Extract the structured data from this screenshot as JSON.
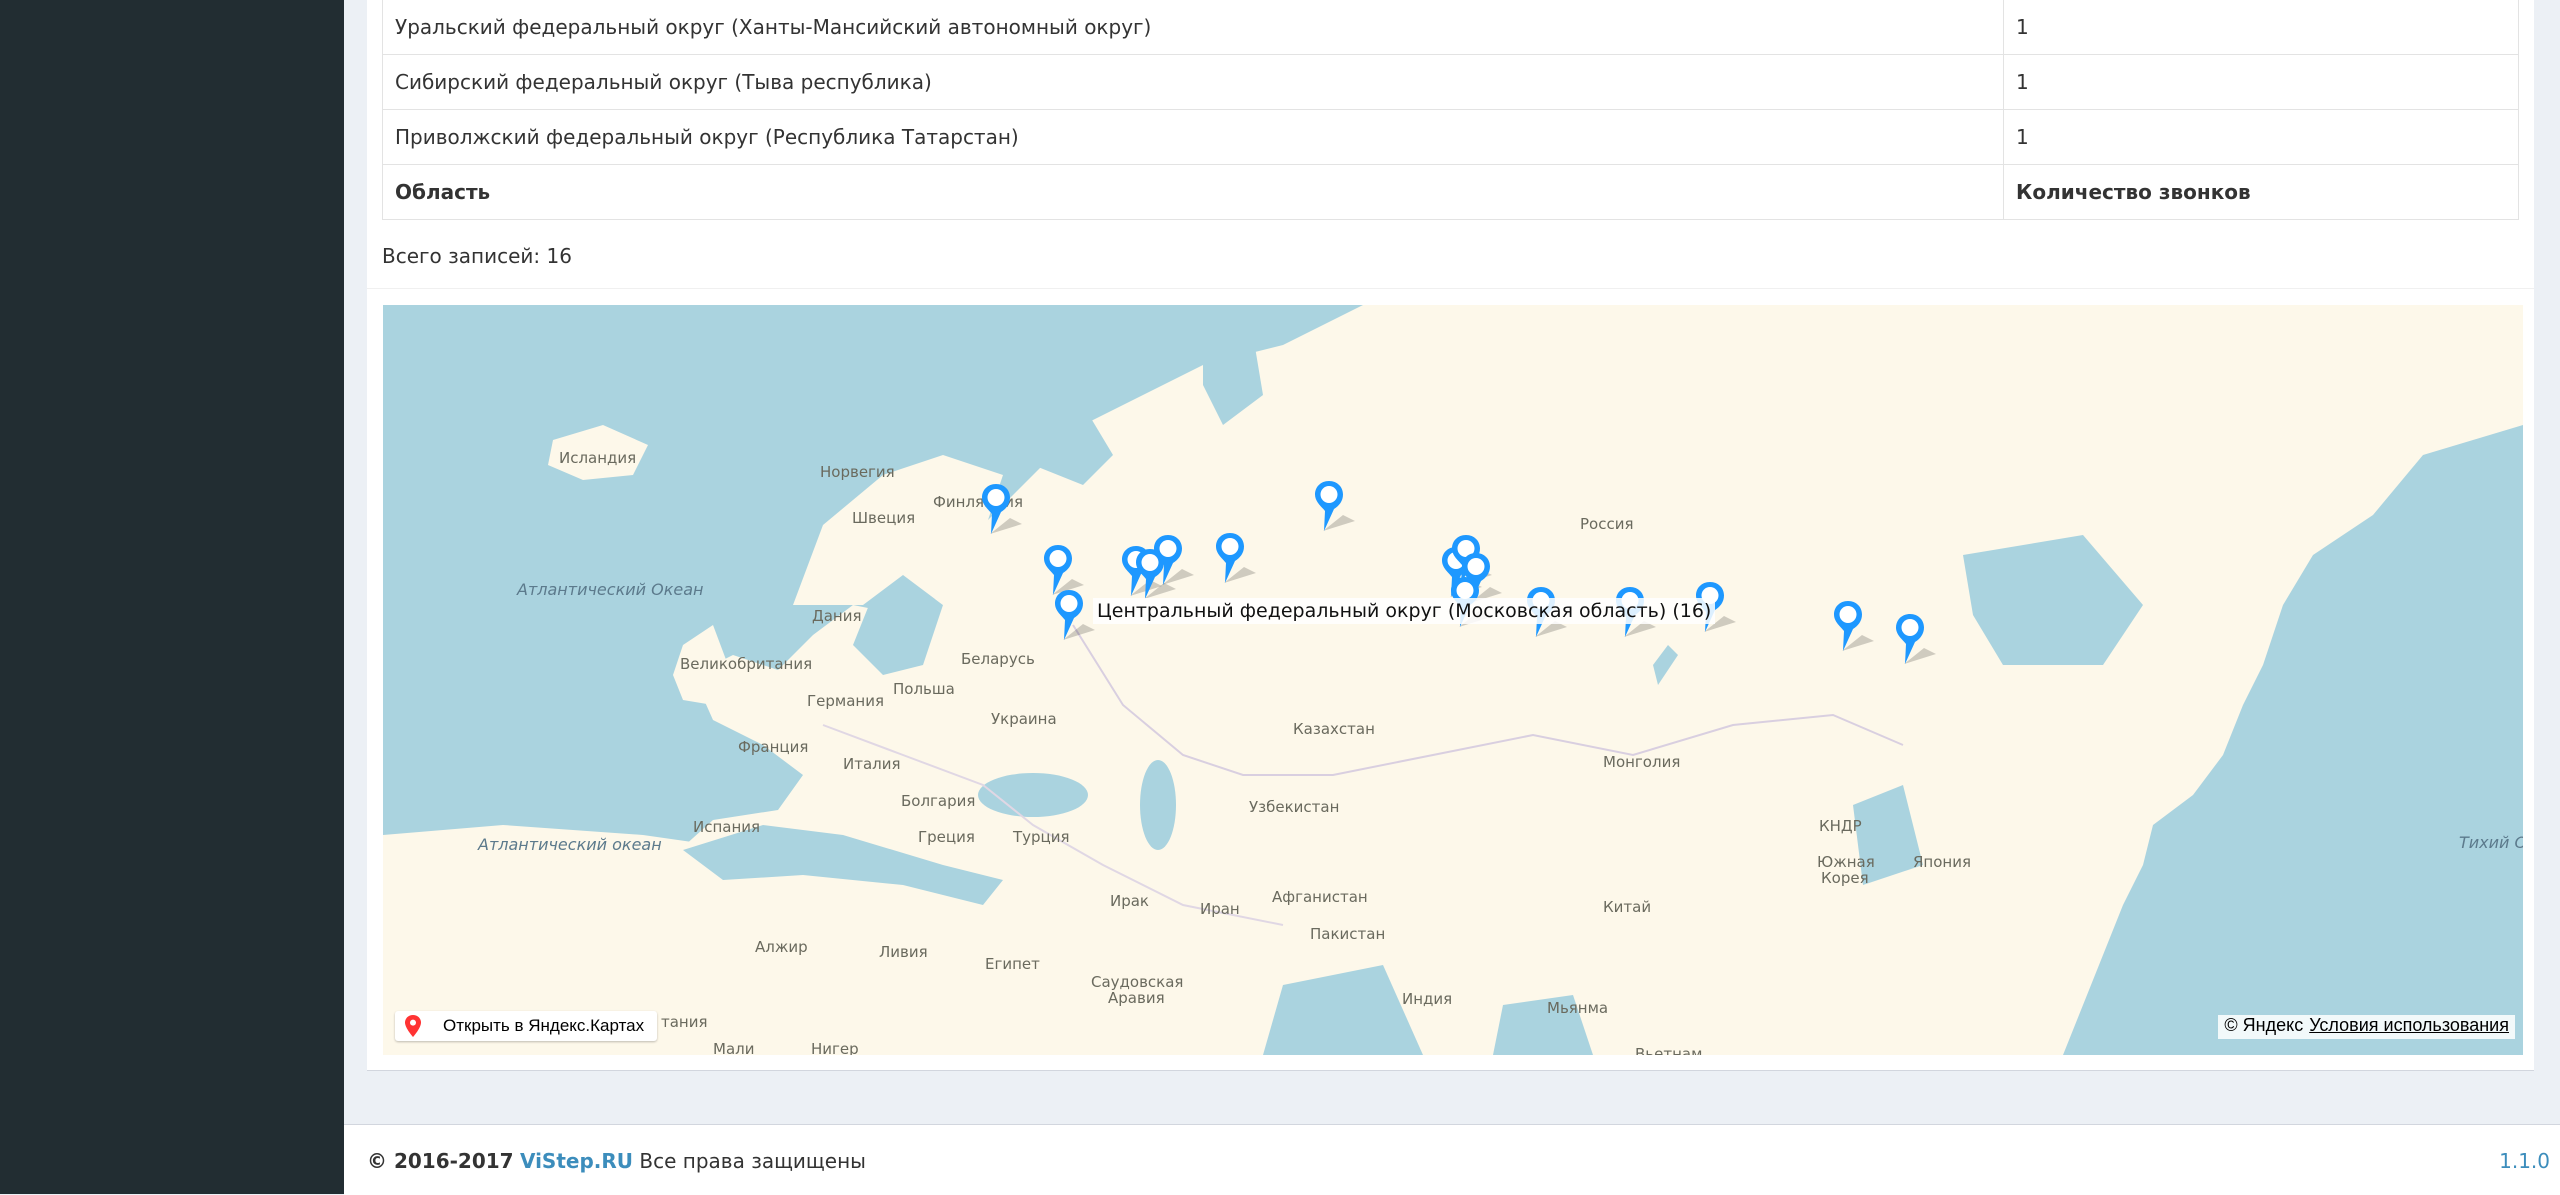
{
  "table": {
    "rows": [
      {
        "region": "Уральский федеральный округ (Ханты-Мансийский автономный округ)",
        "count": "1"
      },
      {
        "region": "Сибирский федеральный округ (Тыва республика)",
        "count": "1"
      },
      {
        "region": "Приволжский федеральный округ (Республика Татарстан)",
        "count": "1"
      }
    ],
    "footer": {
      "region_header": "Область",
      "count_header": "Количество звонков"
    }
  },
  "total_records": "Всего записей: 16",
  "map": {
    "tooltip": "Центральный федеральный округ (Московская область) (16)",
    "open_button_label": "Открыть в Яндекс.Картах",
    "copyright": "© Яндекс",
    "terms_link": "Условия использования",
    "labels": {
      "iceland": "Исландия",
      "norway": "Норвегия",
      "sweden": "Швеция",
      "finland": "Финляндия",
      "russia": "Россия",
      "atlantic_north": "Атлантический Океан",
      "denmark": "Дания",
      "uk": "Великобритания",
      "belarus": "Беларусь",
      "poland": "Польша",
      "germany": "Германия",
      "ukraine": "Украина",
      "france": "Франция",
      "italy": "Италия",
      "bulgaria": "Болгария",
      "kazakhstan": "Казахстан",
      "mongolia": "Монголия",
      "uzbekistan": "Узбекистан",
      "spain": "Испания",
      "greece": "Греция",
      "turkey": "Турция",
      "atlantic_south": "Атлантический океан",
      "north_korea": "КНДР",
      "south_korea_1": "Южная",
      "south_korea_2": "Корея",
      "japan": "Япония",
      "pacific": "Тихий О",
      "iraq": "Ирак",
      "iran": "Иран",
      "afghanistan": "Афганистан",
      "china": "Китай",
      "pakistan": "Пакистан",
      "algeria": "Алжир",
      "libya": "Ливия",
      "egypt": "Египет",
      "saudi_1": "Саудовская",
      "saudi_2": "Аравия",
      "india": "Индия",
      "myanmar": "Мьянма",
      "mauritania": "тания",
      "mali": "Мали",
      "niger": "Нигер",
      "vietnam": "Вьетнам"
    },
    "placemark_count": 17,
    "colors": {
      "water": "#aad3df",
      "land": "#fdf8ea",
      "pin": "#1e98ff"
    }
  },
  "footer": {
    "copyright_years": "© 2016-2017",
    "brand": "ViStep.RU",
    "rights": "Все права защищены",
    "version": "1.1.0"
  }
}
